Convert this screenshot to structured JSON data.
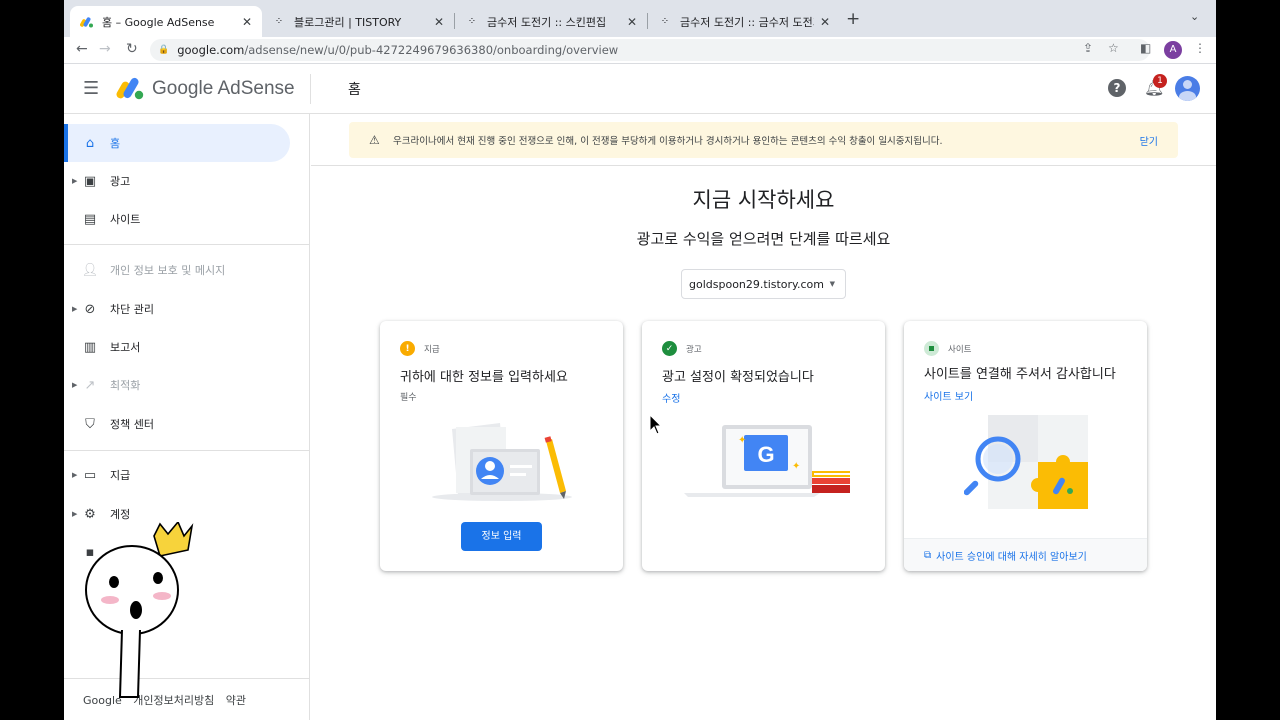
{
  "browser": {
    "tabs": [
      {
        "title": "홈 – Google AdSense",
        "active": true
      },
      {
        "title": "블로그관리 | TISTORY",
        "active": false
      },
      {
        "title": "금수저 도전기 :: 스킨편집",
        "active": false
      },
      {
        "title": "금수저 도전기 :: 금수저 도전기",
        "active": false
      }
    ],
    "url_host": "google.com",
    "url_path": "/adsense/new/u/0/pub-4272249679636380/onboarding/overview",
    "profile_initial": "A"
  },
  "header": {
    "brand": "Google AdSense",
    "page_title": "홈",
    "help_icon": "?",
    "notification_count": "1"
  },
  "sidebar": {
    "items": [
      {
        "label": "홈",
        "icon": "home-icon"
      },
      {
        "label": "광고",
        "icon": "ads-icon"
      },
      {
        "label": "사이트",
        "icon": "sites-icon"
      },
      {
        "label": "개인 정보 보호 및 메시지",
        "icon": "privacy-icon"
      },
      {
        "label": "차단 관리",
        "icon": "block-icon"
      },
      {
        "label": "보고서",
        "icon": "reports-icon"
      },
      {
        "label": "최적화",
        "icon": "optimization-icon"
      },
      {
        "label": "정책 센터",
        "icon": "policy-icon"
      },
      {
        "label": "지급",
        "icon": "payments-icon"
      },
      {
        "label": "계정",
        "icon": "gear-icon"
      }
    ],
    "footer": [
      "Google",
      "개인정보처리방침",
      "약관"
    ]
  },
  "banner": {
    "message": "우크라이나에서 현재 진행 중인 전쟁으로 인해, 이 전쟁을 부당하게 이용하거나 경시하거나 용인하는 콘텐츠의 수익 창출이 일시중지됩니다.",
    "close_label": "닫기"
  },
  "main": {
    "heading": "지금 시작하세요",
    "subheading": "광고로 수익을 얻으려면 단계를 따르세요",
    "site_select": "goldspoon29.tistory.com"
  },
  "cards": [
    {
      "status": "지급",
      "title": "귀하에 대한 정보를 입력하세요",
      "sub": "필수",
      "button": "정보 입력",
      "status_color": "#f9ab00"
    },
    {
      "status": "광고",
      "title": "광고 설정이 확정되었습니다",
      "link": "수정",
      "status_color": "#1e8e3e"
    },
    {
      "status": "사이트",
      "title": "사이트를 연결해 주셔서 감사합니다",
      "link": "사이트 보기",
      "footer_link": "사이트 승인에 대해 자세히 알아보기",
      "status_color": "#ceead6"
    }
  ],
  "colors": {
    "accent": "#1a73e8",
    "banner_bg": "#fef7e0",
    "selected_bg": "#e8f0fe"
  }
}
